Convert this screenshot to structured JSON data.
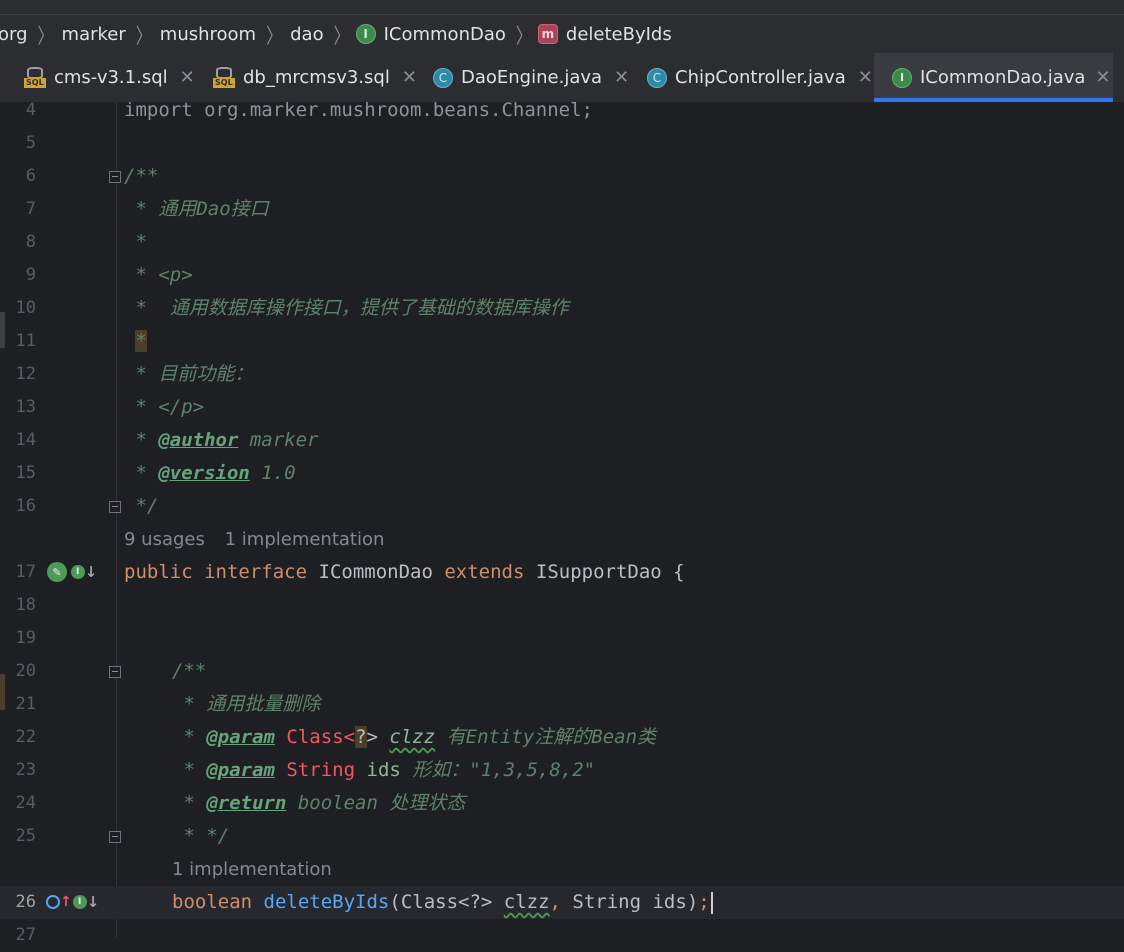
{
  "breadcrumb": {
    "items": [
      "org",
      "marker",
      "mushroom",
      "dao",
      "ICommonDao",
      "deleteByIds"
    ]
  },
  "tabs": [
    {
      "label": "cms-v3.1.sql",
      "icon": "sql-file-icon",
      "active": false
    },
    {
      "label": "db_mrcmsv3.sql",
      "icon": "sql-file-icon",
      "active": false
    },
    {
      "label": "DaoEngine.java",
      "icon": "class-icon",
      "active": false
    },
    {
      "label": "ChipController.java",
      "icon": "class-icon",
      "active": false
    },
    {
      "label": "ICommonDao.java",
      "icon": "interface-icon",
      "active": true
    }
  ],
  "editor": {
    "line_numbers": [
      "4",
      "5",
      "6",
      "7",
      "8",
      "9",
      "10",
      "11",
      "12",
      "13",
      "14",
      "15",
      "16",
      "17",
      "18",
      "19",
      "20",
      "21",
      "22",
      "23",
      "24",
      "25",
      "26",
      "27"
    ],
    "hints": {
      "usages": "9 usages",
      "implementations": "1 implementation",
      "method_implementation": "1 implementation"
    },
    "import_line": "import org.marker.mushroom.beans.Channel;",
    "doc1": {
      "open": "/**",
      "l7": " * 通用Dao接口",
      "l8": " *",
      "l9": " * <p>",
      "l10": " *  通用数据库操作接口，提供了基础的数据库操作",
      "l11_star": "*",
      "l12": " * 目前功能：",
      "l13": " * </p>",
      "l14_star": " * ",
      "l14_tag": "@author",
      "l14_val": " marker",
      "l15_star": " * ",
      "l15_tag": "@version",
      "l15_val": " 1.0",
      "close": " */"
    },
    "decl": {
      "public": "public",
      "interface": "interface",
      "name": "ICommonDao",
      "extends": "extends",
      "parent": "ISupportDao",
      "brace": " {"
    },
    "doc2": {
      "open": "/**",
      "l21": " * 通用批量删除",
      "l22_star": " * ",
      "l22_tag": "@param",
      "l22_type": "Class<",
      "l22_q": "?",
      "l22_close": ">",
      "l22_name": "clzz",
      "l22_desc": " 有Entity注解的Bean类",
      "l23_star": " * ",
      "l23_tag": "@param",
      "l23_type": "String",
      "l23_name": " ids",
      "l23_desc": " 形如：\"1,3,5,8,2\"",
      "l24_star": " * ",
      "l24_tag": "@return",
      "l24_desc": " boolean 处理状态",
      "close": " * */"
    },
    "method": {
      "ret": "boolean",
      "name": "deleteByIds",
      "open": "(Class<?> ",
      "p1": "clzz",
      "comma": ",",
      "rest": " String ids)",
      "semi": ";"
    }
  }
}
